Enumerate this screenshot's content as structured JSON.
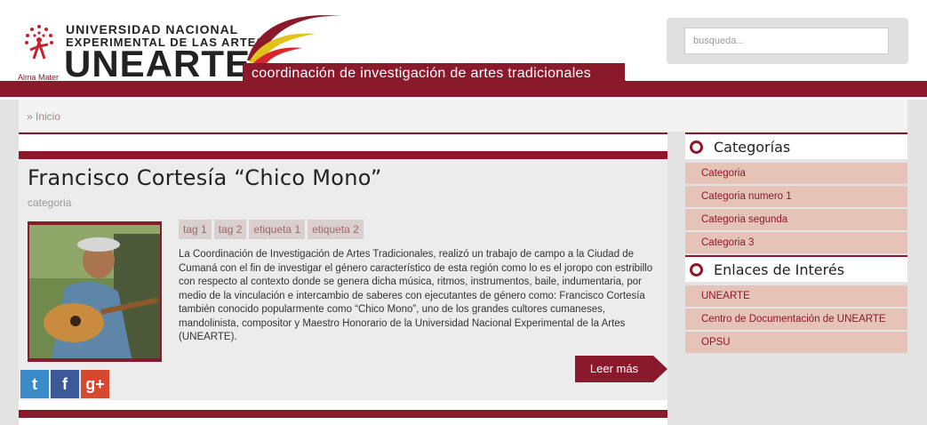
{
  "header": {
    "alma_mater": "Alma Mater",
    "university_line1": "UNIVERSIDAD NACIONAL",
    "university_line2": "EXPERIMENTAL DE LAS ARTES",
    "acronym": "UNEARTE",
    "coordination": "coordinación de investigación de artes tradicionales",
    "search_placeholder": "busqueda..."
  },
  "breadcrumb": {
    "home": "» Inicio"
  },
  "article": {
    "title": "Francisco Cortesía “Chico Mono”",
    "category": "categoria",
    "tags": [
      "tag 1",
      "tag 2",
      "etiqueta 1",
      "etiqueta 2"
    ],
    "body": "La Coordinación de Investigación de Artes Tradicionales, realizó un trabajo de campo a la Ciudad de Cumaná con el fin de investigar el género característico de esta región como lo es el joropo con estribillo con respecto al contexto donde se genera dicha música, ritmos, instrumentos, baile, indumentaria, por medio de la vinculación e intercambio de saberes con ejecutantes de género como: Francisco Cortesía también conocido popularmente como “Chico Mono”, uno de los grandes cultores cumaneses, mandolinista, compositor y Maestro Honorario de la Universidad Nacional Experimental de la Artes (UNEARTE).",
    "read_more": "Leer más"
  },
  "social": [
    {
      "icon": "twitter-icon",
      "glyph": "t",
      "color": "#3a8bc8"
    },
    {
      "icon": "facebook-icon",
      "glyph": "f",
      "color": "#3b5998"
    },
    {
      "icon": "google-plus-icon",
      "glyph": "g+",
      "color": "#d6492f"
    }
  ],
  "sidebar": {
    "categories_title": "Categorías",
    "categories": [
      "Categoria",
      "Categoria numero 1",
      "Categoria segunda",
      "Categoria 3"
    ],
    "links_title": "Enlaces de Interés",
    "links": [
      "UNEARTE",
      "Centro de Documentación de UNEARTE",
      "OPSU"
    ]
  },
  "colors": {
    "brand": "#8a1a2b",
    "sidebar_item": "#e5c3b7"
  }
}
